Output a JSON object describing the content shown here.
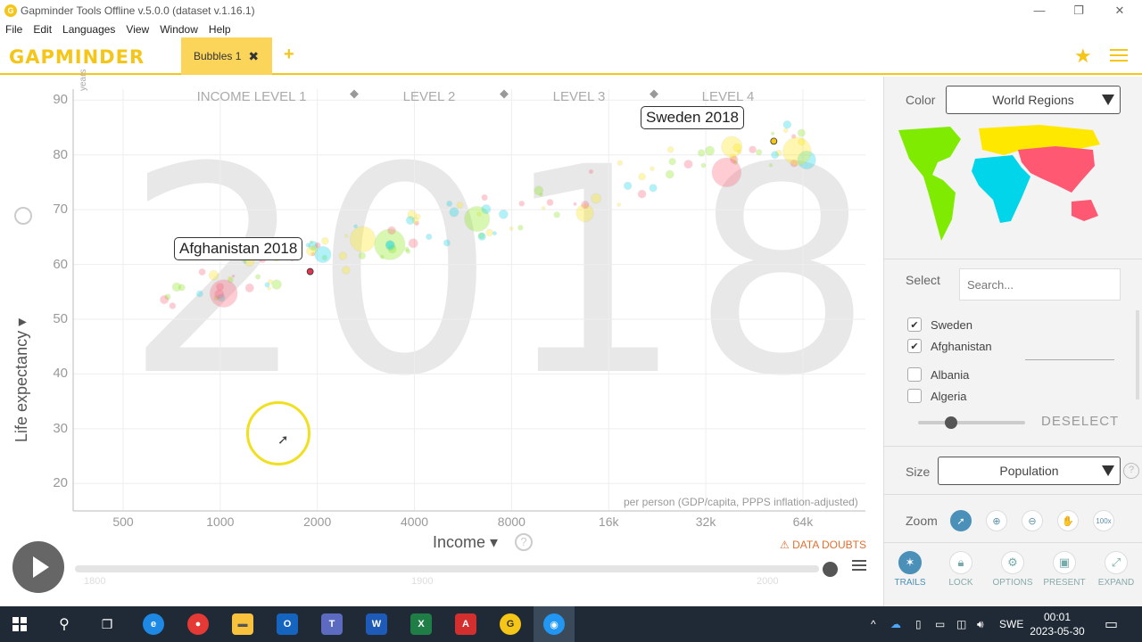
{
  "window": {
    "title": "Gapminder Tools Offline v.5.0.0 (dataset v.1.16.1)",
    "minimize": "—",
    "restore": "❐",
    "close": "✕"
  },
  "menu": [
    "File",
    "Edit",
    "Languages",
    "View",
    "Window",
    "Help"
  ],
  "app": {
    "logo": "GAPMINDER",
    "tab_label": "Bubbles 1",
    "tab_close": "✖",
    "add_tab": "+",
    "star": "★"
  },
  "chart": {
    "big_year": "2018",
    "ylabel": "Life expectancy ▾",
    "yunit": "years",
    "xlabel": "Income ▾",
    "xsub": "per person (GDP/capita, PPPS inflation-adjusted)",
    "yticks": [
      "90",
      "80",
      "70",
      "60",
      "50",
      "40",
      "30",
      "20"
    ],
    "xticks": [
      "500",
      "1000",
      "2000",
      "4000",
      "8000",
      "16k",
      "32k",
      "64k"
    ],
    "levels": [
      "INCOME LEVEL 1",
      "LEVEL 2",
      "LEVEL 3",
      "LEVEL 4"
    ],
    "labels": {
      "sweden": "Sweden 2018",
      "afghanistan": "Afghanistan 2018"
    },
    "data_doubts": "DATA DOUBTS",
    "timeline_years": [
      "1800",
      "1900",
      "2000"
    ]
  },
  "chart_data": {
    "type": "scatter",
    "xlabel": "Income",
    "ylabel": "Life expectancy",
    "x_scale": "log",
    "xlim": [
      350,
      100000
    ],
    "ylim": [
      15,
      92
    ],
    "year": "2018",
    "points": [
      {
        "name": "Sweden",
        "x": 52000,
        "y": 82.5
      },
      {
        "name": "Afghanistan",
        "x": 1900,
        "y": 58.7
      }
    ]
  },
  "sidebar": {
    "color_label": "Color",
    "color_value": "World Regions",
    "select_label": "Select",
    "search_placeholder": "Search...",
    "countries": [
      {
        "name": "Sweden",
        "checked": true
      },
      {
        "name": "Afghanistan",
        "checked": true
      },
      {
        "name": "Albania",
        "checked": false
      },
      {
        "name": "Algeria",
        "checked": false
      }
    ],
    "deselect": "DESELECT",
    "size_label": "Size",
    "size_value": "Population",
    "zoom_label": "Zoom",
    "zoom_100": "100x",
    "bottom": [
      "TRAILS",
      "LOCK",
      "OPTIONS",
      "PRESENT",
      "EXPAND"
    ],
    "region_colors": [
      "#7feb00",
      "#ffe800",
      "#00d5e9",
      "#ff5872"
    ]
  },
  "taskbar": {
    "lang": "SWE",
    "time": "00:01",
    "date": "2023-05-30"
  }
}
